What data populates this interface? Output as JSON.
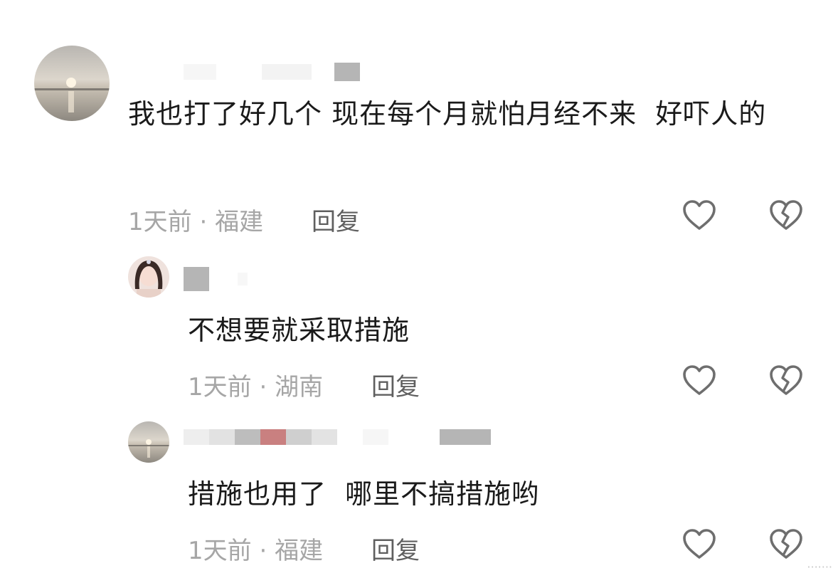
{
  "comments": [
    {
      "text": "我也打了好几个 现在每个月就怕月经不来  好吓人的",
      "time": "1天前",
      "location": "福建",
      "reply_label": "回复"
    },
    {
      "text": "不想要就采取措施",
      "time": "1天前",
      "location": "湖南",
      "reply_label": "回复"
    },
    {
      "text": "措施也用了  哪里不搞措施哟",
      "time": "1天前",
      "location": "福建",
      "reply_label": "回复"
    }
  ],
  "meta_separator": "·",
  "icons": {
    "like": "heart-outline-icon",
    "dislike": "broken-heart-icon"
  },
  "colors": {
    "text": "#1a1a1a",
    "meta": "#a6a6a6",
    "reply": "#5f5f5f",
    "icon": "#6e6e6e"
  },
  "watermark": "·······"
}
